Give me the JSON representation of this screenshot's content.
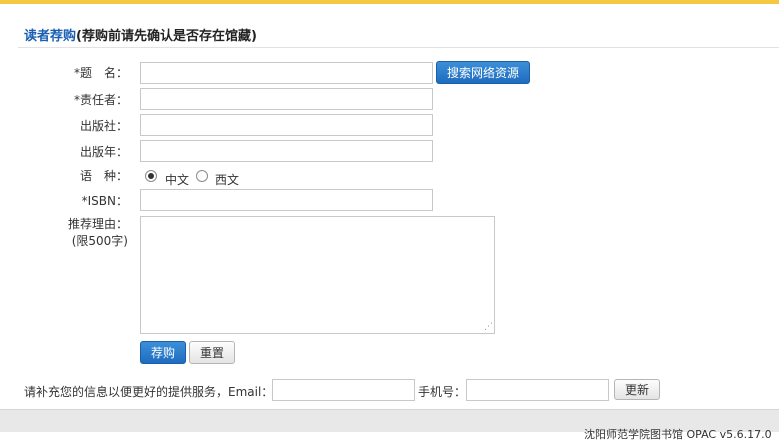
{
  "header": {
    "title": "读者荐购",
    "subtitle": "(荐购前请先确认是否存在馆藏)"
  },
  "form": {
    "title_label": "题　名：",
    "title_required": "*",
    "title_value": "",
    "search_button": "搜索网络资源",
    "author_label": "责任者：",
    "author_required": "*",
    "author_value": "",
    "publisher_label": "出版社：",
    "publisher_value": "",
    "year_label": "出版年：",
    "year_value": "",
    "language_label": "语　种：",
    "language_options": [
      "中文",
      "西文"
    ],
    "language_selected": "中文",
    "isbn_label": "ISBN：",
    "isbn_required": "*",
    "isbn_value": "",
    "reason_label": "推荐理由：",
    "reason_limit": "(限500字)",
    "reason_value": "",
    "submit_button": "荐购",
    "reset_button": "重置"
  },
  "contact": {
    "prompt": "请补充您的信息以便更好的提供服务，Email：",
    "email_value": "",
    "phone_label": "手机号：",
    "phone_value": "",
    "update_button": "更新"
  },
  "footer": {
    "text": "沈阳师范学院图书馆 OPAC v5.6.17.0"
  },
  "colors": {
    "top_bar": "#f5c842",
    "accent": "#1a5fb4",
    "button_blue": "#1e6cc0",
    "footer_bg": "#e8e8e8"
  }
}
